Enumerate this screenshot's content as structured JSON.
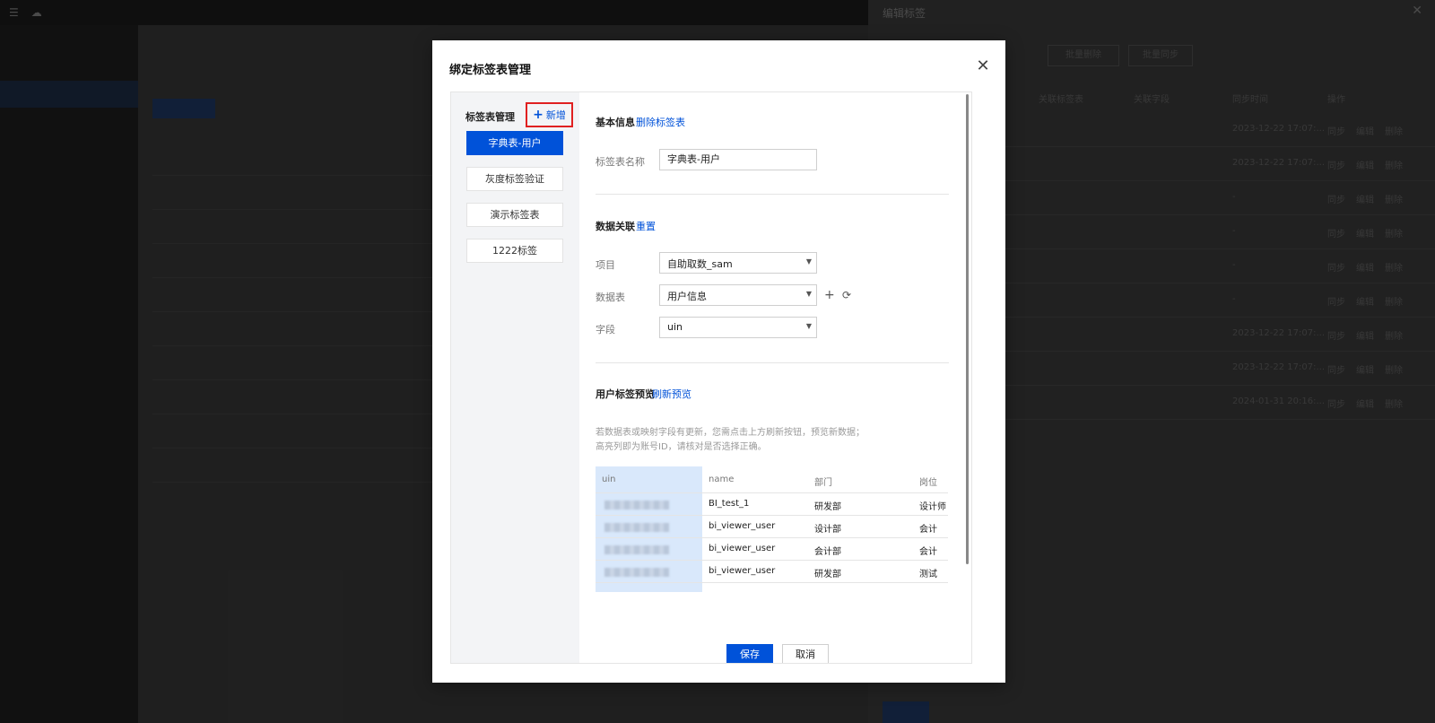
{
  "drawer": {
    "title": "编辑标签",
    "buttons": [
      "批量删除",
      "批量同步"
    ],
    "headers": [
      "关联标签表",
      "关联字段",
      "同步时间",
      "操作"
    ],
    "rows": [
      {
        "time": "2023-12-22 17:07:...",
        "actions": [
          "同步",
          "编辑",
          "删除"
        ]
      },
      {
        "time": "2023-12-22 17:07:...",
        "actions": [
          "同步",
          "编辑",
          "删除"
        ]
      },
      {
        "time": "-",
        "actions": [
          "同步",
          "编辑",
          "删除"
        ]
      },
      {
        "time": "-",
        "actions": [
          "同步",
          "编辑",
          "删除"
        ]
      },
      {
        "time": "-",
        "actions": [
          "同步",
          "编辑",
          "删除"
        ]
      },
      {
        "time": "-",
        "actions": [
          "同步",
          "编辑",
          "删除"
        ]
      },
      {
        "time": "2023-12-22 17:07:...",
        "actions": [
          "同步",
          "编辑",
          "删除"
        ]
      },
      {
        "time": "2023-12-22 17:07:...",
        "actions": [
          "同步",
          "编辑",
          "删除"
        ]
      },
      {
        "time": "2024-01-31 20:16:...",
        "actions": [
          "同步",
          "编辑",
          "删除"
        ]
      }
    ]
  },
  "modal": {
    "title": "绑定标签表管理",
    "left": {
      "title": "标签表管理",
      "add_label": "新增",
      "items": [
        "字典表-用户",
        "灰度标签验证",
        "演示标签表",
        "1222标签"
      ]
    },
    "basic": {
      "title": "基本信息",
      "delete_link": "删除标签表",
      "name_label": "标签表名称",
      "name_value": "字典表-用户"
    },
    "relation": {
      "title": "数据关联",
      "reset_link": "重置",
      "project_label": "项目",
      "project_value": "自助取数_sam",
      "table_label": "数据表",
      "table_value": "用户信息",
      "field_label": "字段",
      "field_value": "uin"
    },
    "preview": {
      "title": "用户标签预览",
      "refresh_link": "刷新预览",
      "hint_line1": "若数据表或映射字段有更新，您需点击上方刷新按钮，预览新数据；",
      "hint_line2": "高亮列即为账号ID，请核对是否选择正确。",
      "headers": [
        "uin",
        "name",
        "部门",
        "岗位"
      ],
      "rows": [
        {
          "name": "BI_test_1",
          "dept": "研发部",
          "role": "设计师"
        },
        {
          "name": "bi_viewer_user",
          "dept": "设计部",
          "role": "会计"
        },
        {
          "name": "bi_viewer_user",
          "dept": "会计部",
          "role": "会计"
        },
        {
          "name": "bi_viewer_user",
          "dept": "研发部",
          "role": "测试"
        }
      ]
    },
    "save_label": "保存",
    "cancel_label": "取消"
  }
}
